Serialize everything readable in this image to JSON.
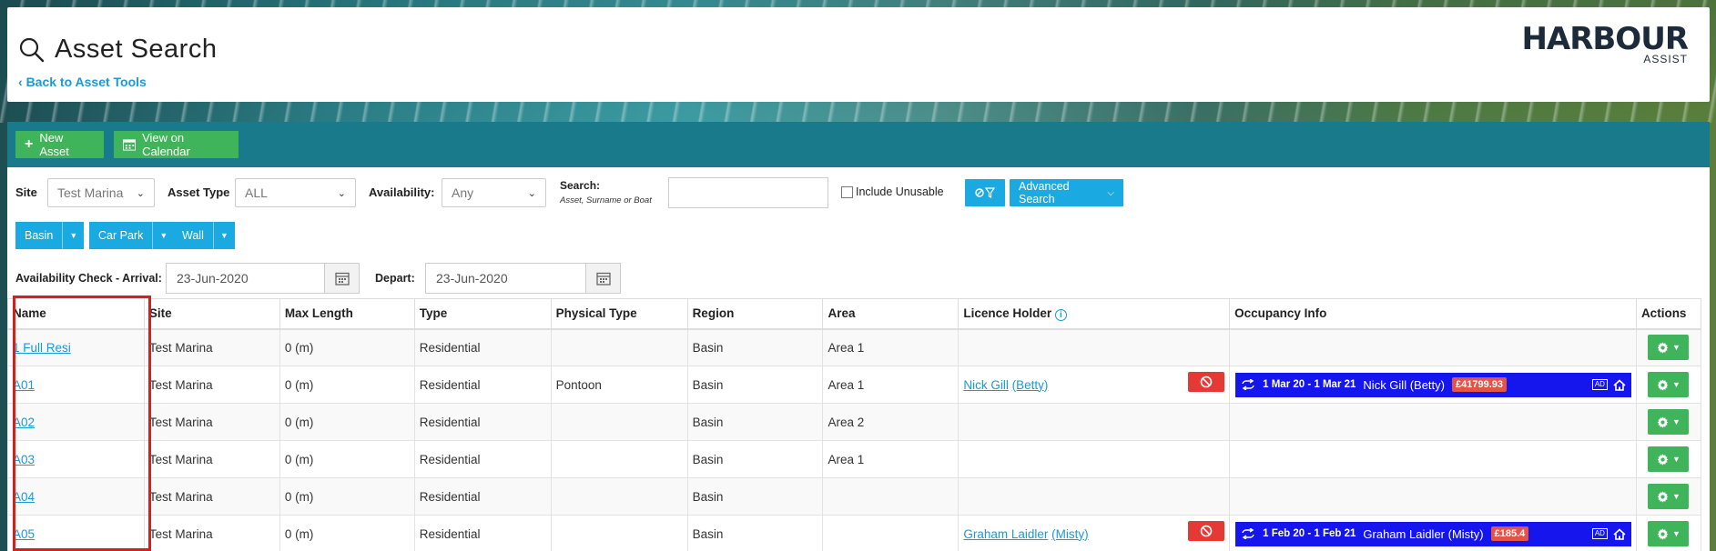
{
  "header": {
    "title": "Asset Search",
    "back_link": "Back to Asset Tools",
    "logo_main": "HARBOUR",
    "logo_sub": "ASSIST"
  },
  "toolbar": {
    "new_asset": "New Asset",
    "view_calendar": "View on Calendar"
  },
  "filters": {
    "site_label": "Site",
    "site_value": "Test Marina",
    "asset_type_label": "Asset Type",
    "asset_type_value": "ALL",
    "availability_label": "Availability:",
    "availability_value": "Any",
    "search_label": "Search:",
    "search_hint": "Asset, Surname or Boat",
    "search_value": "",
    "include_unusable": "Include Unusable",
    "advanced_search": "Advanced Search",
    "groups": [
      "Basin",
      "Car Park",
      "Wall"
    ],
    "arrival_label": "Availability Check - Arrival:",
    "arrival_value": "23-Jun-2020",
    "depart_label": "Depart:",
    "depart_value": "23-Jun-2020"
  },
  "table": {
    "columns": [
      "Name",
      "Site",
      "Max Length",
      "Type",
      "Physical Type",
      "Region",
      "Area",
      "Licence Holder",
      "Occupancy Info",
      "Actions"
    ],
    "rows": [
      {
        "name": "1 Full Resi",
        "site": "Test Marina",
        "max_length": "0 (m)",
        "type": "Residential",
        "physical_type": "",
        "region": "Basin",
        "area": "Area 1",
        "holder": "",
        "holder_boat": "",
        "occupancy": null
      },
      {
        "name": "A01",
        "site": "Test Marina",
        "max_length": "0 (m)",
        "type": "Residential",
        "physical_type": "Pontoon",
        "region": "Basin",
        "area": "Area 1",
        "holder": "Nick Gill",
        "holder_boat": "(Betty)",
        "occupancy": {
          "dates": "1 Mar 20 - 1 Mar 21",
          "name": "Nick Gill (Betty)",
          "price": "£41799.93",
          "ad": "AD"
        }
      },
      {
        "name": "A02",
        "site": "Test Marina",
        "max_length": "0 (m)",
        "type": "Residential",
        "physical_type": "",
        "region": "Basin",
        "area": "Area 2",
        "holder": "",
        "holder_boat": "",
        "occupancy": null
      },
      {
        "name": "A03",
        "site": "Test Marina",
        "max_length": "0 (m)",
        "type": "Residential",
        "physical_type": "",
        "region": "Basin",
        "area": "Area 1",
        "holder": "",
        "holder_boat": "",
        "occupancy": null
      },
      {
        "name": "A04",
        "site": "Test Marina",
        "max_length": "0 (m)",
        "type": "Residential",
        "physical_type": "",
        "region": "Basin",
        "area": "",
        "holder": "",
        "holder_boat": "",
        "occupancy": null
      },
      {
        "name": "A05",
        "site": "Test Marina",
        "max_length": "0 (m)",
        "type": "Residential",
        "physical_type": "",
        "region": "Basin",
        "area": "",
        "holder": "Graham Laidler",
        "holder_boat": "(Misty)",
        "occupancy": {
          "dates": "1 Feb 20 - 1 Feb 21",
          "name": "Graham Laidler (Misty)",
          "price": "£185.4",
          "ad": "AD"
        }
      }
    ]
  },
  "icons": {
    "title": "search-icon",
    "back": "chevron-left-icon",
    "new": "plus-icon",
    "calendar": "calendar-icon",
    "filter": "filter-clear-icon",
    "gear": "gear-icon",
    "ban": "ban-icon",
    "repeat": "repeat-icon",
    "home": "home-icon"
  },
  "colors": {
    "primary_green": "#3fb45a",
    "primary_blue": "#1aa9e0",
    "toolbar_teal": "#197a8c",
    "occupancy_blue": "#1515ee",
    "danger_red": "#e53935",
    "link": "#1a9ad6"
  }
}
